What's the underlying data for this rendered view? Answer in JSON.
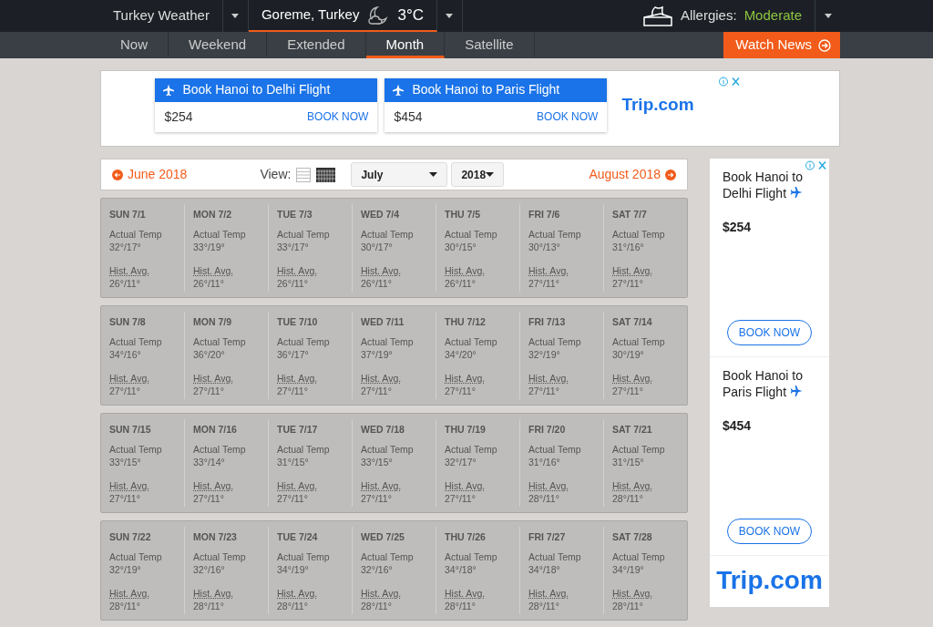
{
  "top_bar": {
    "site": "Turkey Weather",
    "location": "Goreme, Turkey",
    "temperature": "3°C",
    "allergies_label": "Allergies:",
    "allergies_level": "Moderate"
  },
  "nav_tabs": [
    {
      "label": "Now",
      "selected": false
    },
    {
      "label": "Weekend",
      "selected": false
    },
    {
      "label": "Extended",
      "selected": false
    },
    {
      "label": "Month",
      "selected": true
    },
    {
      "label": "Satellite",
      "selected": false
    }
  ],
  "watch_news": "Watch News",
  "banner_ad": {
    "offers": [
      {
        "title": "Book Hanoi to Delhi Flight",
        "price": "$254",
        "button": "BOOK NOW"
      },
      {
        "title": "Book Hanoi to Paris Flight",
        "price": "$454",
        "button": "BOOK NOW"
      }
    ],
    "brand": "Trip.com"
  },
  "calendar": {
    "prev": "June 2018",
    "view_label": "View:",
    "views": [
      {
        "kind": "list",
        "selected": false
      },
      {
        "kind": "grid",
        "selected": true
      }
    ],
    "month": "July",
    "year": "2018",
    "next": "August 2018",
    "weeks": [
      [
        {
          "day": "SUN 7/1",
          "actual_label": "Actual Temp",
          "actual": "32°/17°",
          "hist_label": "Hist. Avg.",
          "hist": "26°/11°"
        },
        {
          "day": "MON 7/2",
          "actual_label": "Actual Temp",
          "actual": "33°/19°",
          "hist_label": "Hist. Avg.",
          "hist": "26°/11°"
        },
        {
          "day": "TUE 7/3",
          "actual_label": "Actual Temp",
          "actual": "33°/17°",
          "hist_label": "Hist. Avg.",
          "hist": "26°/11°"
        },
        {
          "day": "WED 7/4",
          "actual_label": "Actual Temp",
          "actual": "30°/17°",
          "hist_label": "Hist. Avg.",
          "hist": "26°/11°"
        },
        {
          "day": "THU 7/5",
          "actual_label": "Actual Temp",
          "actual": "30°/15°",
          "hist_label": "Hist. Avg.",
          "hist": "26°/11°"
        },
        {
          "day": "FRI 7/6",
          "actual_label": "Actual Temp",
          "actual": "30°/13°",
          "hist_label": "Hist. Avg.",
          "hist": "27°/11°"
        },
        {
          "day": "SAT 7/7",
          "actual_label": "Actual Temp",
          "actual": "31°/16°",
          "hist_label": "Hist. Avg.",
          "hist": "27°/11°"
        }
      ],
      [
        {
          "day": "SUN 7/8",
          "actual_label": "Actual Temp",
          "actual": "34°/16°",
          "hist_label": "Hist. Avg.",
          "hist": "27°/11°"
        },
        {
          "day": "MON 7/9",
          "actual_label": "Actual Temp",
          "actual": "36°/20°",
          "hist_label": "Hist. Avg.",
          "hist": "27°/11°"
        },
        {
          "day": "TUE 7/10",
          "actual_label": "Actual Temp",
          "actual": "36°/17°",
          "hist_label": "Hist. Avg.",
          "hist": "27°/11°"
        },
        {
          "day": "WED 7/11",
          "actual_label": "Actual Temp",
          "actual": "37°/19°",
          "hist_label": "Hist. Avg.",
          "hist": "27°/11°"
        },
        {
          "day": "THU 7/12",
          "actual_label": "Actual Temp",
          "actual": "34°/20°",
          "hist_label": "Hist. Avg.",
          "hist": "27°/11°"
        },
        {
          "day": "FRI 7/13",
          "actual_label": "Actual Temp",
          "actual": "32°/19°",
          "hist_label": "Hist. Avg.",
          "hist": "27°/11°"
        },
        {
          "day": "SAT 7/14",
          "actual_label": "Actual Temp",
          "actual": "30°/19°",
          "hist_label": "Hist. Avg.",
          "hist": "27°/11°"
        }
      ],
      [
        {
          "day": "SUN 7/15",
          "actual_label": "Actual Temp",
          "actual": "33°/15°",
          "hist_label": "Hist. Avg.",
          "hist": "27°/11°"
        },
        {
          "day": "MON 7/16",
          "actual_label": "Actual Temp",
          "actual": "33°/14°",
          "hist_label": "Hist. Avg.",
          "hist": "27°/11°"
        },
        {
          "day": "TUE 7/17",
          "actual_label": "Actual Temp",
          "actual": "31°/15°",
          "hist_label": "Hist. Avg.",
          "hist": "27°/11°"
        },
        {
          "day": "WED 7/18",
          "actual_label": "Actual Temp",
          "actual": "33°/15°",
          "hist_label": "Hist. Avg.",
          "hist": "27°/11°"
        },
        {
          "day": "THU 7/19",
          "actual_label": "Actual Temp",
          "actual": "32°/17°",
          "hist_label": "Hist. Avg.",
          "hist": "27°/11°"
        },
        {
          "day": "FRI 7/20",
          "actual_label": "Actual Temp",
          "actual": "31°/16°",
          "hist_label": "Hist. Avg.",
          "hist": "28°/11°"
        },
        {
          "day": "SAT 7/21",
          "actual_label": "Actual Temp",
          "actual": "31°/15°",
          "hist_label": "Hist. Avg.",
          "hist": "28°/11°"
        }
      ],
      [
        {
          "day": "SUN 7/22",
          "actual_label": "Actual Temp",
          "actual": "32°/19°",
          "hist_label": "Hist. Avg.",
          "hist": "28°/11°"
        },
        {
          "day": "MON 7/23",
          "actual_label": "Actual Temp",
          "actual": "32°/16°",
          "hist_label": "Hist. Avg.",
          "hist": "28°/11°"
        },
        {
          "day": "TUE 7/24",
          "actual_label": "Actual Temp",
          "actual": "34°/19°",
          "hist_label": "Hist. Avg.",
          "hist": "28°/11°"
        },
        {
          "day": "WED 7/25",
          "actual_label": "Actual Temp",
          "actual": "32°/16°",
          "hist_label": "Hist. Avg.",
          "hist": "28°/11°"
        },
        {
          "day": "THU 7/26",
          "actual_label": "Actual Temp",
          "actual": "34°/18°",
          "hist_label": "Hist. Avg.",
          "hist": "28°/11°"
        },
        {
          "day": "FRI 7/27",
          "actual_label": "Actual Temp",
          "actual": "34°/18°",
          "hist_label": "Hist. Avg.",
          "hist": "28°/11°"
        },
        {
          "day": "SAT 7/28",
          "actual_label": "Actual Temp",
          "actual": "34°/19°",
          "hist_label": "Hist. Avg.",
          "hist": "28°/11°"
        }
      ]
    ]
  },
  "side_ad": {
    "offers": [
      {
        "title": "Book Hanoi to Delhi Flight",
        "price": "$254",
        "button": "BOOK NOW"
      },
      {
        "title": "Book Hanoi to Paris Flight",
        "price": "$454",
        "button": "BOOK NOW"
      }
    ],
    "brand": "Trip.com"
  }
}
